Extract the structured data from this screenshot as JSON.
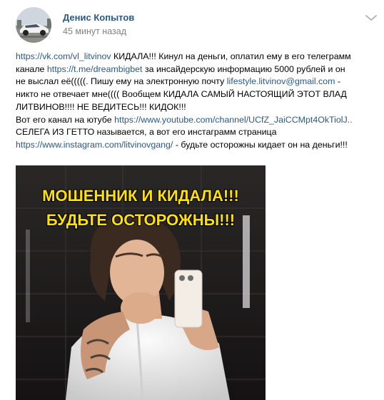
{
  "post": {
    "author_name": "Денис Копытов",
    "time": "45 минут назад",
    "menu_icon": "chevron-down-icon",
    "text": {
      "line1": {
        "link1": "https://vk.com/vl_litvinov",
        "text1": " КИДАЛА!!! Кинул на деньги, оплатил ему в его телеграмм"
      },
      "line2": {
        "text1": "канале ",
        "link1": "https://t.me/dreambigbet",
        "text2": " за инсайдерскую информацию 5000 рублей и он"
      },
      "line3": {
        "text1": "не выслал её(((((. Пишу ему на электронную почту ",
        "link1": "lifestyle.litvinov@gmail.com",
        "text2": " -"
      },
      "line4": {
        "text1": "никто не отвечает мне(((( Вообщем КИДАЛА САМЫЙ НАСТОЯЩИЙ ЭТОТ ВЛАД"
      },
      "line5": {
        "text1": "ЛИТВИНОВ!!!! НЕ ВЕДИТЕСЬ!!! КИДОК!!!"
      },
      "line6": {
        "text1": "Вот его канал на ютубе ",
        "link1": "https://www.youtube.com/channel/UCfZ_JaiCCMpt4OkTiolJ.."
      },
      "line7": {
        "text1": "СЕЛЕГА ИЗ ГЕТТО называется, а вот его инстаграмм страница"
      },
      "line8": {
        "link1": "https://www.instagram.com/litvinovgang/",
        "text1": " - будьте осторожны кидает он на деньги!!!"
      }
    },
    "image": {
      "banner_line1": "МОШЕННИК И КИДАЛА!!!",
      "banner_line2": "БУДЬТЕ ОСТОРОЖНЫ!!!"
    }
  },
  "colors": {
    "link": "#2a5885",
    "secondary_text": "#828282",
    "banner_text": "#ffe100"
  }
}
